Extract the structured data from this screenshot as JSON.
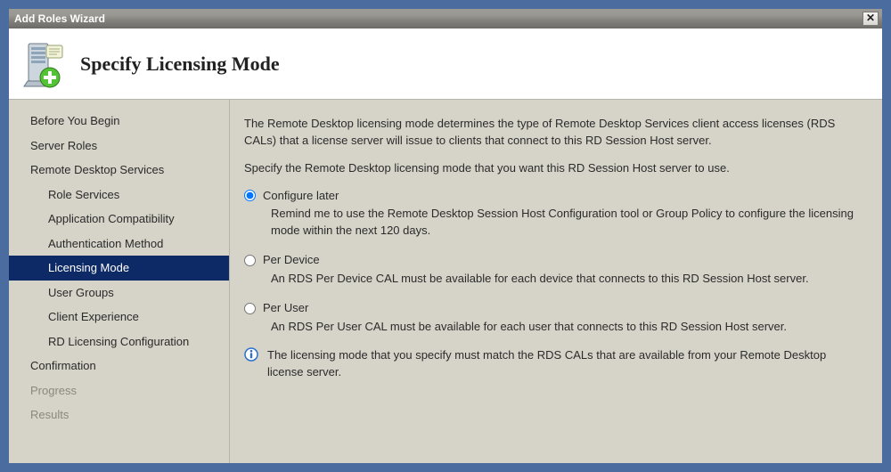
{
  "window": {
    "title": "Add Roles Wizard"
  },
  "header": {
    "title": "Specify Licensing Mode"
  },
  "sidebar": {
    "items": [
      {
        "label": "Before You Begin",
        "sub": false,
        "selected": false,
        "dim": false
      },
      {
        "label": "Server Roles",
        "sub": false,
        "selected": false,
        "dim": false
      },
      {
        "label": "Remote Desktop Services",
        "sub": false,
        "selected": false,
        "dim": false
      },
      {
        "label": "Role Services",
        "sub": true,
        "selected": false,
        "dim": false
      },
      {
        "label": "Application Compatibility",
        "sub": true,
        "selected": false,
        "dim": false
      },
      {
        "label": "Authentication Method",
        "sub": true,
        "selected": false,
        "dim": false
      },
      {
        "label": "Licensing Mode",
        "sub": true,
        "selected": true,
        "dim": false
      },
      {
        "label": "User Groups",
        "sub": true,
        "selected": false,
        "dim": false
      },
      {
        "label": "Client Experience",
        "sub": true,
        "selected": false,
        "dim": false
      },
      {
        "label": "RD Licensing Configuration",
        "sub": true,
        "selected": false,
        "dim": false
      },
      {
        "label": "Confirmation",
        "sub": false,
        "selected": false,
        "dim": false
      },
      {
        "label": "Progress",
        "sub": false,
        "selected": false,
        "dim": true
      },
      {
        "label": "Results",
        "sub": false,
        "selected": false,
        "dim": true
      }
    ]
  },
  "content": {
    "intro1": "The Remote Desktop licensing mode determines the type of Remote Desktop Services client access licenses (RDS CALs) that a license server will issue to clients that connect to this RD Session Host server.",
    "intro2": "Specify the Remote Desktop licensing mode that you want this RD Session Host server to use.",
    "options": {
      "selected": "configure_later",
      "configure_later": {
        "label": "Configure later",
        "desc": "Remind me to use the Remote Desktop Session Host Configuration tool or Group Policy to configure the licensing mode within the next 120 days."
      },
      "per_device": {
        "label": "Per Device",
        "desc": "An RDS Per Device CAL must be available for each device that connects to this RD Session Host server."
      },
      "per_user": {
        "label": "Per User",
        "desc": "An RDS Per User CAL must be available for each user that connects to this RD Session Host server."
      }
    },
    "info": "The licensing mode that you specify must match the RDS CALs that are available from your Remote Desktop license server."
  }
}
